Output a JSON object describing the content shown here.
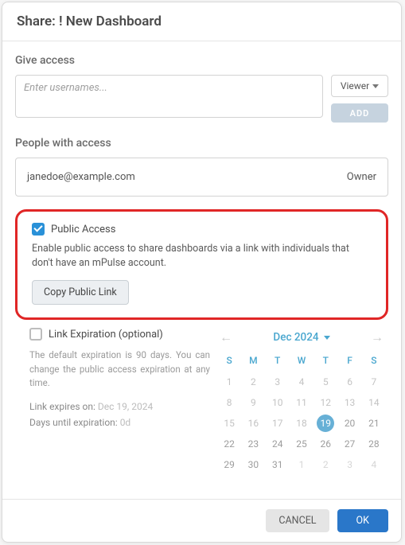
{
  "header": {
    "title": "Share: ! New Dashboard"
  },
  "giveAccess": {
    "title": "Give access",
    "placeholder": "Enter usernames...",
    "roleLabel": "Viewer",
    "addLabel": "ADD"
  },
  "peopleAccess": {
    "title": "People with access",
    "rows": [
      {
        "email": "janedoe@example.com",
        "role": "Owner"
      }
    ]
  },
  "publicAccess": {
    "label": "Public Access",
    "description": "Enable public access to share dashboards via a link with individuals that don't have an mPulse account.",
    "copyLabel": "Copy Public Link"
  },
  "linkExpiration": {
    "label": "Link Expiration (optional)",
    "description": "The default expiration is 90 days. You can change the public access expiration at any time.",
    "expiresOnLabel": "Link expires on:",
    "expiresOnValue": "Dec 19, 2024",
    "daysUntilLabel": "Days until expiration:",
    "daysUntilValue": "0d"
  },
  "calendar": {
    "monthLabel": "Dec 2024",
    "dow": [
      "S",
      "M",
      "T",
      "W",
      "T",
      "F",
      "S"
    ],
    "weeks": [
      [
        {
          "d": "1",
          "m": true
        },
        {
          "d": "2",
          "m": true
        },
        {
          "d": "3",
          "m": true
        },
        {
          "d": "4",
          "m": true
        },
        {
          "d": "5",
          "m": true
        },
        {
          "d": "6",
          "m": true
        },
        {
          "d": "7",
          "m": true
        }
      ],
      [
        {
          "d": "8",
          "m": true
        },
        {
          "d": "9",
          "m": true
        },
        {
          "d": "10",
          "m": true
        },
        {
          "d": "11",
          "m": true
        },
        {
          "d": "12",
          "m": true
        },
        {
          "d": "13",
          "m": true
        },
        {
          "d": "14",
          "m": true
        }
      ],
      [
        {
          "d": "15",
          "m": true
        },
        {
          "d": "16",
          "m": true
        },
        {
          "d": "17",
          "m": true
        },
        {
          "d": "18",
          "m": true
        },
        {
          "d": "19",
          "m": true,
          "sel": true
        },
        {
          "d": "20",
          "m": true,
          "dark": true
        },
        {
          "d": "21",
          "m": true,
          "dark": true
        }
      ],
      [
        {
          "d": "22",
          "m": true,
          "dark": true
        },
        {
          "d": "23",
          "m": true,
          "dark": true
        },
        {
          "d": "24",
          "m": true,
          "dark": true
        },
        {
          "d": "25",
          "m": true,
          "dark": true
        },
        {
          "d": "26",
          "m": true,
          "dark": true
        },
        {
          "d": "27",
          "m": true,
          "dark": true
        },
        {
          "d": "28",
          "m": true,
          "dark": true
        }
      ],
      [
        {
          "d": "29",
          "m": true,
          "dark": true
        },
        {
          "d": "30",
          "m": true,
          "dark": true
        },
        {
          "d": "31",
          "m": true,
          "dark": true
        },
        {
          "d": "1",
          "m": false
        },
        {
          "d": "2",
          "m": false
        },
        {
          "d": "3",
          "m": false
        },
        {
          "d": "4",
          "m": false
        }
      ]
    ]
  },
  "footer": {
    "cancel": "CANCEL",
    "ok": "OK"
  }
}
